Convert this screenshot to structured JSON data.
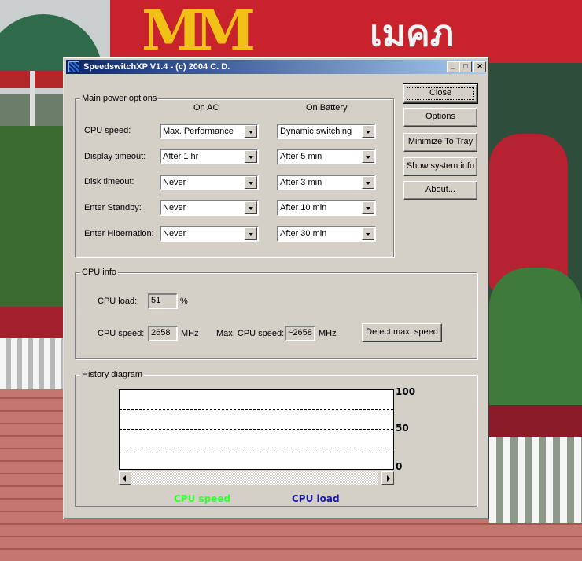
{
  "window": {
    "title": "SpeedswitchXP V1.4 - (c) 2004 C. D.",
    "controls": {
      "minimize": "_",
      "maximize": "□",
      "close": "✕"
    }
  },
  "power": {
    "group_label": "Main power options",
    "col_ac": "On AC",
    "col_battery": "On Battery",
    "rows": [
      {
        "label": "CPU speed:",
        "ac": "Max. Performance",
        "battery": "Dynamic switching"
      },
      {
        "label": "Display timeout:",
        "ac": "After 1 hr",
        "battery": "After 5 min"
      },
      {
        "label": "Disk timeout:",
        "ac": "Never",
        "battery": "After 3 min"
      },
      {
        "label": "Enter Standby:",
        "ac": "Never",
        "battery": "After 10 min"
      },
      {
        "label": "Enter Hibernation:",
        "ac": "Never",
        "battery": "After 30 min"
      }
    ]
  },
  "buttons": {
    "close": "Close",
    "options": "Options",
    "minimize_tray": "Minimize To Tray",
    "sysinfo": "Show system info",
    "about": "About..."
  },
  "cpu": {
    "group_label": "CPU info",
    "load_label": "CPU load:",
    "load_value": "51",
    "load_unit": "%",
    "speed_label": "CPU speed:",
    "speed_value": "2658",
    "speed_unit": "MHz",
    "max_label": "Max. CPU speed:",
    "max_value": "~2658",
    "max_unit": "MHz",
    "detect_label": "Detect max. speed"
  },
  "history": {
    "group_label": "History diagram",
    "axis_top": "100",
    "axis_mid": "50",
    "axis_bottom": "0",
    "legend_speed": "CPU speed",
    "legend_load": "CPU load",
    "colors": {
      "speed": "#33ff33",
      "load": "#1a1aa6"
    }
  }
}
